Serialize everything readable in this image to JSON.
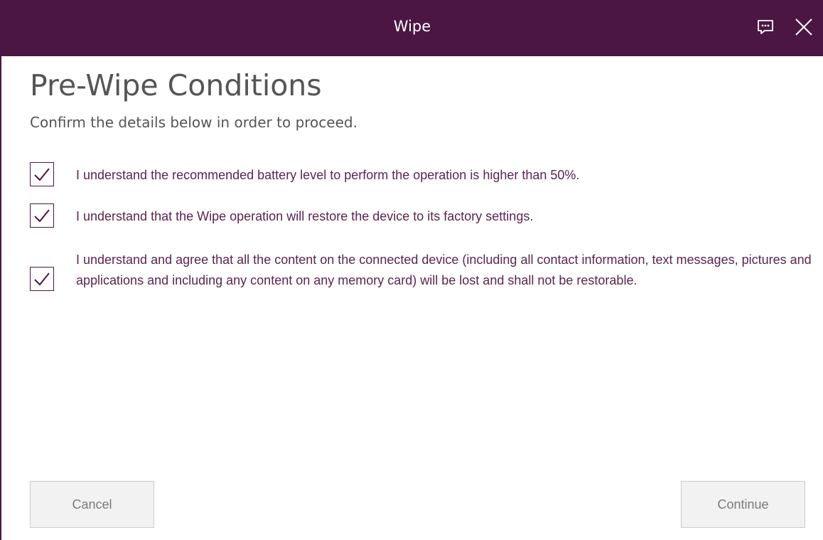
{
  "window": {
    "title": "Wipe",
    "accent_color": "#4b1742"
  },
  "titlebar": {
    "icons": [
      "feedback-icon",
      "close-icon"
    ]
  },
  "main": {
    "heading": "Pre-Wipe Conditions",
    "subheading": "Confirm the details below in order to proceed.",
    "conditions": [
      {
        "checked": true,
        "text": "I understand the recommended battery level to perform the operation is higher than 50%."
      },
      {
        "checked": true,
        "text": "I understand that the Wipe operation will restore the device to its factory settings."
      },
      {
        "checked": true,
        "text": "I understand and agree that all the content on the connected device (including all contact information, text messages, pictures and applications and including any content on any memory card) will be lost and shall not be restorable."
      }
    ]
  },
  "footer": {
    "cancel_label": "Cancel",
    "continue_label": "Continue"
  }
}
